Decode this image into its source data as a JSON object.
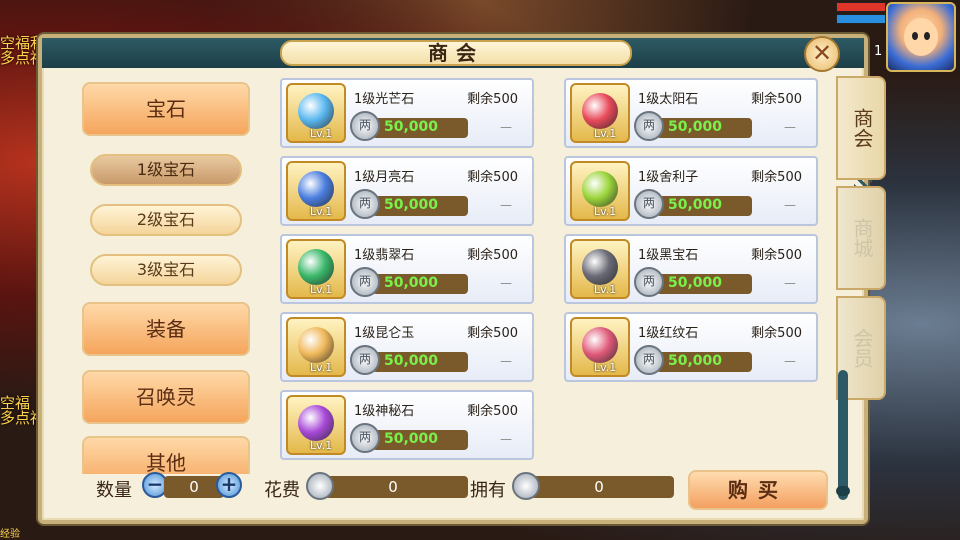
{
  "background": {
    "left_text_top": "空福利\n多点福",
    "left_text_bottom": "空福\n多点福",
    "exp_label": "经验"
  },
  "hud": {
    "level_badge": "1"
  },
  "panel": {
    "title": "商会",
    "close_label": "✕"
  },
  "categories": [
    {
      "label": "宝石",
      "type": "main",
      "active": true
    },
    {
      "label": "1级宝石",
      "type": "sub",
      "active": true
    },
    {
      "label": "2级宝石",
      "type": "sub",
      "active": false
    },
    {
      "label": "3级宝石",
      "type": "sub",
      "active": false
    },
    {
      "label": "装备",
      "type": "main",
      "active": false
    },
    {
      "label": "召唤灵",
      "type": "main",
      "active": false
    },
    {
      "label": "其他",
      "type": "main",
      "active": false
    }
  ],
  "items": [
    {
      "name": "1级光芒石",
      "stock": "剩余500",
      "price": "50,000",
      "level": "Lv.1",
      "gem_color": "#5ab8f0",
      "owned": "—"
    },
    {
      "name": "1级太阳石",
      "stock": "剩余500",
      "price": "50,000",
      "level": "Lv.1",
      "gem_color": "#e84a5a",
      "owned": "—"
    },
    {
      "name": "1级月亮石",
      "stock": "剩余500",
      "price": "50,000",
      "level": "Lv.1",
      "gem_color": "#4a7ee0",
      "owned": "—"
    },
    {
      "name": "1级舍利子",
      "stock": "剩余500",
      "price": "50,000",
      "level": "Lv.1",
      "gem_color": "#9ad43a",
      "owned": "—"
    },
    {
      "name": "1级翡翠石",
      "stock": "剩余500",
      "price": "50,000",
      "level": "Lv.1",
      "gem_color": "#3ab86a",
      "owned": "—"
    },
    {
      "name": "1级黑宝石",
      "stock": "剩余500",
      "price": "50,000",
      "level": "Lv.1",
      "gem_color": "#6a6a76",
      "owned": "—"
    },
    {
      "name": "1级昆仑玉",
      "stock": "剩余500",
      "price": "50,000",
      "level": "Lv.1",
      "gem_color": "#f0b85a",
      "owned": "—"
    },
    {
      "name": "1级红纹石",
      "stock": "剩余500",
      "price": "50,000",
      "level": "Lv.1",
      "gem_color": "#e05a7a",
      "owned": "—"
    },
    {
      "name": "1级神秘石",
      "stock": "剩余500",
      "price": "50,000",
      "level": "Lv.1",
      "gem_color": "#a84ad8",
      "owned": "—"
    }
  ],
  "coin_glyph": "两",
  "tabs": [
    {
      "label": "商会",
      "active": true
    },
    {
      "label": "商城",
      "active": false
    },
    {
      "label": "会员",
      "active": false
    }
  ],
  "bottom": {
    "qty_label": "数量",
    "qty_value": "0",
    "minus": "−",
    "plus": "+",
    "cost_label": "花费",
    "cost_value": "0",
    "own_label": "拥有",
    "own_value": "0",
    "buy_label": "购买"
  },
  "colors": {
    "accent_teal": "#2d5a64",
    "price_green": "#7af04a",
    "button_orange": "#f3a060"
  }
}
